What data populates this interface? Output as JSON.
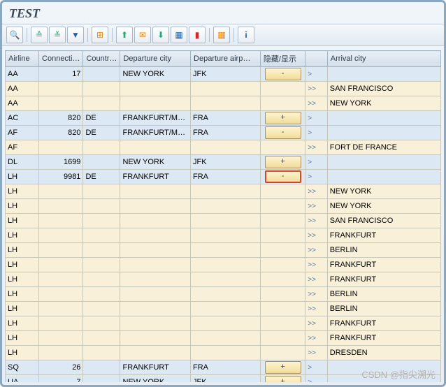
{
  "title": "TEST",
  "watermark": "CSDN @指尖溯光",
  "toolbar": {
    "find": "🔍",
    "sort_asc": "▲",
    "sort_desc": "▼",
    "filter": "⚗",
    "sum": "Σ",
    "export": "⬇",
    "mail": "✉",
    "excel": "⬇",
    "word": "⬇",
    "chart": "📊",
    "layout": "▦",
    "info": "ℹ"
  },
  "headers": {
    "airline": "Airline",
    "connection": "Connecti…",
    "country": "Countr…",
    "dep_city": "Departure city",
    "dep_airport": "Departure airp…",
    "hide_show": "隐藏/显示",
    "arrow": "",
    "arr_city": "Arrival city"
  },
  "rows": [
    {
      "blue": true,
      "air": "AA",
      "con": "17",
      "cou": "",
      "dep": "NEW YORK",
      "apt": "JFK",
      "btn": "-",
      "sel": false,
      "ar": ">",
      "arr": ""
    },
    {
      "air": "AA",
      "con": "",
      "cou": "",
      "dep": "",
      "apt": "",
      "btn": "",
      "ar": ">>",
      "arr": "SAN FRANCISCO"
    },
    {
      "air": "AA",
      "con": "",
      "cou": "",
      "dep": "",
      "apt": "",
      "btn": "",
      "ar": ">>",
      "arr": "NEW YORK"
    },
    {
      "blue": true,
      "air": "AC",
      "con": "820",
      "cou": "DE",
      "dep": "FRANKFURT/M…",
      "apt": "FRA",
      "btn": "+",
      "sel": false,
      "ar": ">",
      "arr": ""
    },
    {
      "blue": true,
      "air": "AF",
      "con": "820",
      "cou": "DE",
      "dep": "FRANKFURT/M…",
      "apt": "FRA",
      "btn": "-",
      "sel": false,
      "ar": ">",
      "arr": ""
    },
    {
      "air": "AF",
      "con": "",
      "cou": "",
      "dep": "",
      "apt": "",
      "btn": "",
      "ar": ">>",
      "arr": "FORT DE FRANCE"
    },
    {
      "blue": true,
      "air": "DL",
      "con": "1699",
      "cou": "",
      "dep": "NEW YORK",
      "apt": "JFK",
      "btn": "+",
      "sel": false,
      "ar": ">",
      "arr": ""
    },
    {
      "blue": true,
      "air": "LH",
      "con": "9981",
      "cou": "DE",
      "dep": "FRANKFURT",
      "apt": "FRA",
      "btn": "-",
      "sel": true,
      "ar": ">",
      "arr": ""
    },
    {
      "air": "LH",
      "con": "",
      "cou": "",
      "dep": "",
      "apt": "",
      "btn": "",
      "ar": ">>",
      "arr": "NEW YORK"
    },
    {
      "air": "LH",
      "con": "",
      "cou": "",
      "dep": "",
      "apt": "",
      "btn": "",
      "ar": ">>",
      "arr": "NEW YORK"
    },
    {
      "air": "LH",
      "con": "",
      "cou": "",
      "dep": "",
      "apt": "",
      "btn": "",
      "ar": ">>",
      "arr": "SAN FRANCISCO"
    },
    {
      "air": "LH",
      "con": "",
      "cou": "",
      "dep": "",
      "apt": "",
      "btn": "",
      "ar": ">>",
      "arr": "FRANKFURT"
    },
    {
      "air": "LH",
      "con": "",
      "cou": "",
      "dep": "",
      "apt": "",
      "btn": "",
      "ar": ">>",
      "arr": "BERLIN"
    },
    {
      "air": "LH",
      "con": "",
      "cou": "",
      "dep": "",
      "apt": "",
      "btn": "",
      "ar": ">>",
      "arr": "FRANKFURT"
    },
    {
      "air": "LH",
      "con": "",
      "cou": "",
      "dep": "",
      "apt": "",
      "btn": "",
      "ar": ">>",
      "arr": "FRANKFURT"
    },
    {
      "air": "LH",
      "con": "",
      "cou": "",
      "dep": "",
      "apt": "",
      "btn": "",
      "ar": ">>",
      "arr": "BERLIN"
    },
    {
      "air": "LH",
      "con": "",
      "cou": "",
      "dep": "",
      "apt": "",
      "btn": "",
      "ar": ">>",
      "arr": "BERLIN"
    },
    {
      "air": "LH",
      "con": "",
      "cou": "",
      "dep": "",
      "apt": "",
      "btn": "",
      "ar": ">>",
      "arr": "FRANKFURT"
    },
    {
      "air": "LH",
      "con": "",
      "cou": "",
      "dep": "",
      "apt": "",
      "btn": "",
      "ar": ">>",
      "arr": "FRANKFURT"
    },
    {
      "air": "LH",
      "con": "",
      "cou": "",
      "dep": "",
      "apt": "",
      "btn": "",
      "ar": ">>",
      "arr": "DRESDEN"
    },
    {
      "blue": true,
      "air": "SQ",
      "con": "26",
      "cou": "",
      "dep": "FRANKFURT",
      "apt": "FRA",
      "btn": "+",
      "sel": false,
      "ar": ">",
      "arr": ""
    },
    {
      "blue": true,
      "air": "UA",
      "con": "7",
      "cou": "",
      "dep": "NEW YORK",
      "apt": "JFK",
      "btn": "+",
      "sel": false,
      "ar": ">",
      "arr": ""
    }
  ]
}
